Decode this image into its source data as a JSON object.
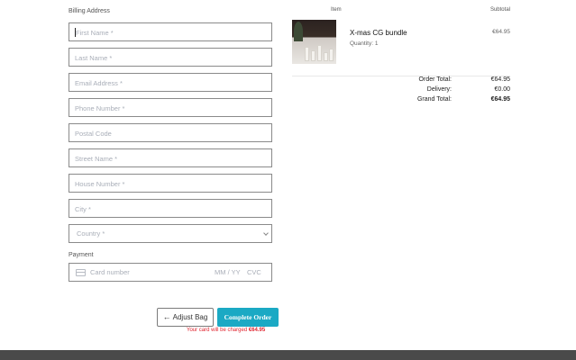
{
  "billing": {
    "title": "Billing Address",
    "fields": {
      "first_name": "First Name *",
      "last_name": "Last Name *",
      "email": "Email Address *",
      "phone": "Phone Number *",
      "postal_code": "Postal Code",
      "street": "Street Name *",
      "house_number": "House Number *",
      "city": "City *",
      "country": "Country *"
    }
  },
  "payment": {
    "title": "Payment",
    "card_number_placeholder": "Card number",
    "expiry_placeholder": "MM / YY",
    "cvc_placeholder": "CVC"
  },
  "actions": {
    "adjust_label": "Adjust Bag",
    "complete_label": "Complete Order",
    "charge_note_prefix": "Your card will be charged",
    "charge_amount": "€64.95"
  },
  "summary": {
    "col_item": "Item",
    "col_subtotal": "Subtotal",
    "product": {
      "name": "X-mas CG bundle",
      "quantity": "Quantity: 1",
      "price": "€64.95"
    },
    "totals": [
      {
        "label": "Order Total:",
        "value": "€64.95"
      },
      {
        "label": "Delivery:",
        "value": "€0.00"
      },
      {
        "label": "Grand Total:",
        "value": "€64.95"
      }
    ]
  },
  "colors": {
    "accent": "#1ba9c4",
    "warning": "#e0242f",
    "footer": "#4a4a4a"
  }
}
